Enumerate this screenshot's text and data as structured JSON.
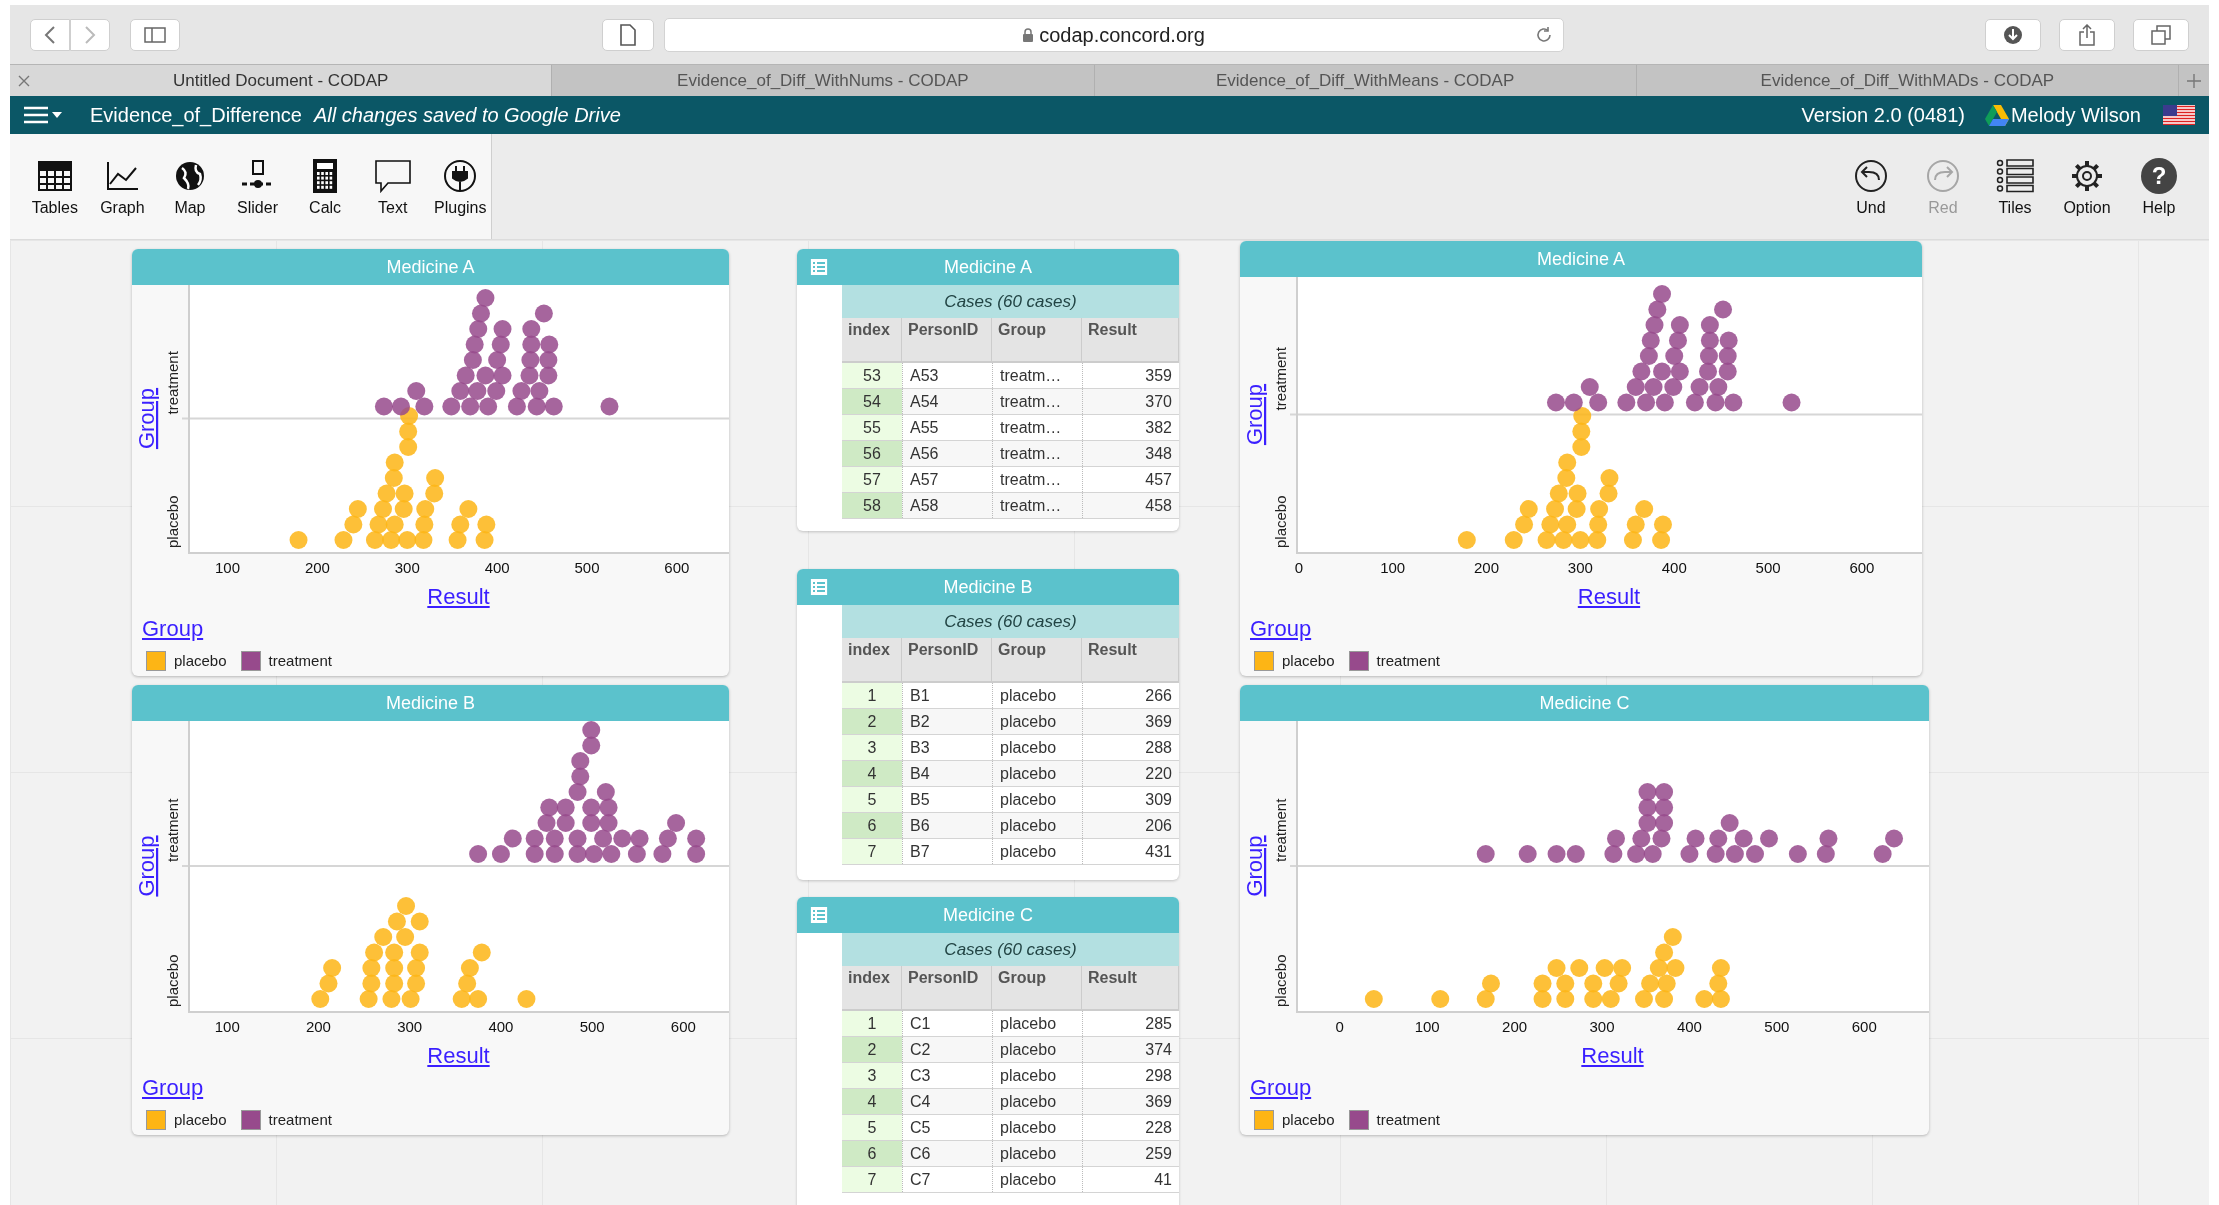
{
  "browser": {
    "url": "codap.concord.org",
    "tabs": [
      {
        "title": "Untitled Document - CODAP",
        "selected": true
      },
      {
        "title": "Evidence_of_Diff_WithNums - CODAP",
        "selected": false
      },
      {
        "title": "Evidence_of_Diff_WithMeans - CODAP",
        "selected": false
      },
      {
        "title": "Evidence_of_Diff_WithMADs - CODAP",
        "selected": false
      }
    ]
  },
  "app_bar": {
    "document": "Evidence_of_Difference",
    "save_status": "All changes saved to Google Drive",
    "version": "Version 2.0 (0481)",
    "user": "Melody Wilson"
  },
  "toolbar": {
    "left": [
      {
        "label": "Tables",
        "kind": "tables"
      },
      {
        "label": "Graph",
        "kind": "graph"
      },
      {
        "label": "Map",
        "kind": "map"
      },
      {
        "label": "Slider",
        "kind": "slider"
      },
      {
        "label": "Calc",
        "kind": "calc"
      },
      {
        "label": "Text",
        "kind": "text"
      },
      {
        "label": "Plugins",
        "kind": "plugins"
      }
    ],
    "right": [
      {
        "label": "Und",
        "kind": "undo",
        "disabled": false
      },
      {
        "label": "Red",
        "kind": "redo",
        "disabled": true
      },
      {
        "label": "Tiles",
        "kind": "tiles",
        "disabled": false
      },
      {
        "label": "Option",
        "kind": "options",
        "disabled": false
      },
      {
        "label": "Help",
        "kind": "help",
        "glyph": "?",
        "disabled": false
      }
    ]
  },
  "graphs": [
    {
      "title": "Medicine A",
      "y_attribute": "Group",
      "y_categories": [
        "treatment",
        "placebo"
      ],
      "x_ticks": [
        "100",
        "200",
        "300",
        "400",
        "500",
        "600"
      ],
      "x_attribute": "Result",
      "legend_attribute": "Group",
      "legend": [
        {
          "label": "placebo",
          "color": "#fdb515"
        },
        {
          "label": "treatment",
          "color": "#974a8c"
        }
      ]
    },
    {
      "title": "Medicine B",
      "y_attribute": "Group",
      "y_categories": [
        "treatment",
        "placebo"
      ],
      "x_ticks": [
        "100",
        "200",
        "300",
        "400",
        "500",
        "600"
      ],
      "x_attribute": "Result",
      "legend_attribute": "Group",
      "legend": [
        {
          "label": "placebo",
          "color": "#fdb515"
        },
        {
          "label": "treatment",
          "color": "#974a8c"
        }
      ]
    },
    {
      "title": "Medicine A",
      "y_attribute": "Group",
      "y_categories": [
        "treatment",
        "placebo"
      ],
      "x_ticks": [
        "0",
        "100",
        "200",
        "300",
        "400",
        "500",
        "600"
      ],
      "x_attribute": "Result",
      "legend_attribute": "Group",
      "legend": [
        {
          "label": "placebo",
          "color": "#fdb515"
        },
        {
          "label": "treatment",
          "color": "#974a8c"
        }
      ]
    },
    {
      "title": "Medicine C",
      "y_attribute": "Group",
      "y_categories": [
        "treatment",
        "placebo"
      ],
      "x_ticks": [
        "0",
        "100",
        "200",
        "300",
        "400",
        "500",
        "600"
      ],
      "x_attribute": "Result",
      "legend_attribute": "Group",
      "legend": [
        {
          "label": "placebo",
          "color": "#fdb515"
        },
        {
          "label": "treatment",
          "color": "#974a8c"
        }
      ]
    }
  ],
  "tables": [
    {
      "title": "Medicine A",
      "cases_label": "Cases (60 cases)",
      "columns": [
        "index",
        "PersonID",
        "Group",
        "Result"
      ],
      "rows": [
        [
          "53",
          "A53",
          "treatm…",
          "359"
        ],
        [
          "54",
          "A54",
          "treatm…",
          "370"
        ],
        [
          "55",
          "A55",
          "treatm…",
          "382"
        ],
        [
          "56",
          "A56",
          "treatm…",
          "348"
        ],
        [
          "57",
          "A57",
          "treatm…",
          "457"
        ],
        [
          "58",
          "A58",
          "treatm…",
          "458"
        ]
      ]
    },
    {
      "title": "Medicine B",
      "cases_label": "Cases (60 cases)",
      "columns": [
        "index",
        "PersonID",
        "Group",
        "Result"
      ],
      "rows": [
        [
          "1",
          "B1",
          "placebo",
          "266"
        ],
        [
          "2",
          "B2",
          "placebo",
          "369"
        ],
        [
          "3",
          "B3",
          "placebo",
          "288"
        ],
        [
          "4",
          "B4",
          "placebo",
          "220"
        ],
        [
          "5",
          "B5",
          "placebo",
          "309"
        ],
        [
          "6",
          "B6",
          "placebo",
          "206"
        ],
        [
          "7",
          "B7",
          "placebo",
          "431"
        ]
      ]
    },
    {
      "title": "Medicine C",
      "cases_label": "Cases (60 cases)",
      "columns": [
        "index",
        "PersonID",
        "Group",
        "Result"
      ],
      "rows": [
        [
          "1",
          "C1",
          "placebo",
          "285"
        ],
        [
          "2",
          "C2",
          "placebo",
          "374"
        ],
        [
          "3",
          "C3",
          "placebo",
          "298"
        ],
        [
          "4",
          "C4",
          "placebo",
          "369"
        ],
        [
          "5",
          "C5",
          "placebo",
          "228"
        ],
        [
          "6",
          "C6",
          "placebo",
          "259"
        ],
        [
          "7",
          "C7",
          "placebo",
          "41"
        ]
      ]
    }
  ]
}
